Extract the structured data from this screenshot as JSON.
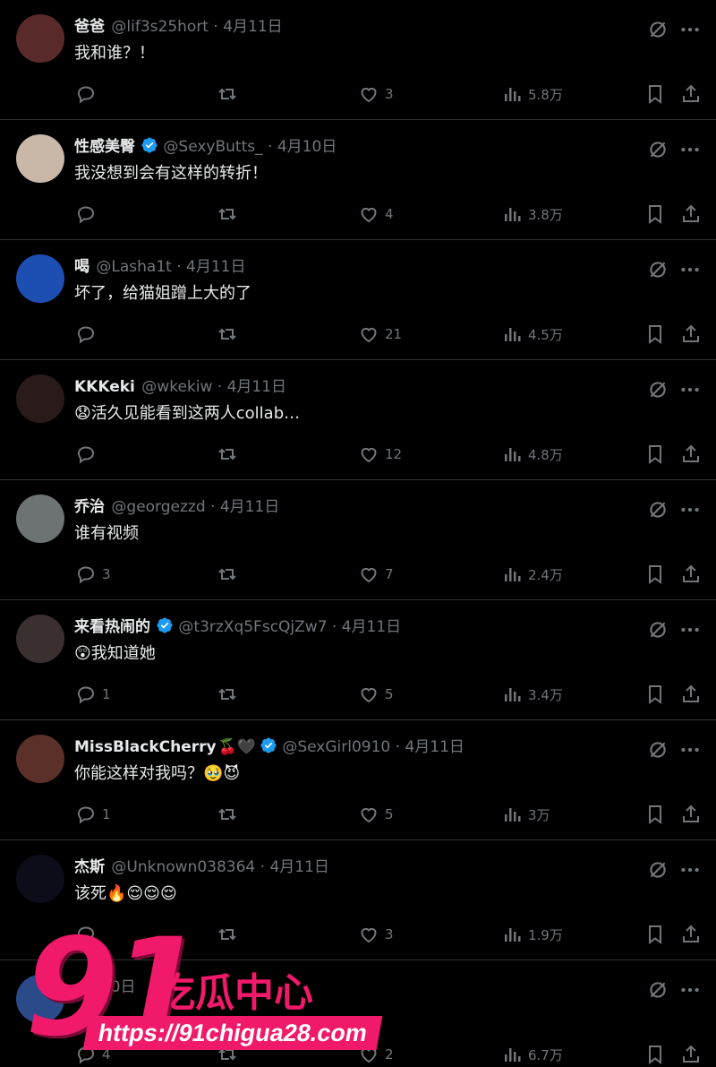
{
  "tweets": [
    {
      "name": "爸爸",
      "verified": false,
      "name_emojis": "",
      "handle": "@lif3s25hort",
      "date": "4月11日",
      "text": "我和谁？！",
      "replies": "",
      "retweets": "",
      "likes": "3",
      "views": "5.8万",
      "avatar_color": "#5a2a2a"
    },
    {
      "name": "性感美臀",
      "verified": true,
      "name_emojis": "",
      "handle": "@SexyButts_",
      "date": "4月10日",
      "text": "我没想到会有这样的转折！",
      "replies": "",
      "retweets": "",
      "likes": "4",
      "views": "3.8万",
      "avatar_color": "#c9b8a8"
    },
    {
      "name": "喝",
      "verified": false,
      "name_emojis": "",
      "handle": "@Lasha1t",
      "date": "4月11日",
      "text": "坏了，给猫姐蹭上大的了",
      "replies": "",
      "retweets": "",
      "likes": "21",
      "views": "4.5万",
      "avatar_color": "#1d4fb3"
    },
    {
      "name": "KKKeki",
      "verified": false,
      "name_emojis": "",
      "handle": "@wkekiw",
      "date": "4月11日",
      "text": "活久见能看到这两人collab…",
      "text_emoji": "😧",
      "replies": "",
      "retweets": "",
      "likes": "12",
      "views": "4.8万",
      "avatar_color": "#2a1a1a"
    },
    {
      "name": "乔治",
      "verified": false,
      "name_emojis": "",
      "handle": "@georgezzd",
      "date": "4月11日",
      "text": "谁有视频",
      "replies": "3",
      "retweets": "",
      "likes": "7",
      "views": "2.4万",
      "avatar_color": "#6d7373"
    },
    {
      "name": "来看热闹的",
      "verified": true,
      "name_emojis": "",
      "handle": "@t3rzXq5FscQjZw7",
      "date": "4月11日",
      "text": "我知道她",
      "text_emoji": "😲",
      "replies": "1",
      "retweets": "",
      "likes": "5",
      "views": "3.4万",
      "avatar_color": "#3a3030"
    },
    {
      "name": "MissBlackCherry",
      "verified": true,
      "name_emojis": "🍒🖤",
      "handle": "@SexGirl0910",
      "date": "4月11日",
      "text": "你能这样对我吗？🥹😈",
      "replies": "1",
      "retweets": "",
      "likes": "5",
      "views": "3万",
      "avatar_color": "#5a3028"
    },
    {
      "name": "杰斯",
      "verified": false,
      "name_emojis": "",
      "handle": "@Unknown038364",
      "date": "4月11日",
      "text": "该死🔥😌😌😌",
      "replies": "",
      "retweets": "",
      "likes": "3",
      "views": "1.9万",
      "avatar_color": "#0d0d1a"
    },
    {
      "name": "",
      "verified": false,
      "name_emojis": "",
      "handle": "",
      "date": "4月10日",
      "text": "",
      "replies": "4",
      "retweets": "",
      "likes": "2",
      "views": "6.7万",
      "avatar_color": "#2a4a8a"
    }
  ],
  "watermark": {
    "number": "91",
    "brand": "吃瓜中心",
    "url": "https://91chigua28.com"
  },
  "colors": {
    "background": "#000000",
    "text": "#e7e9ea",
    "muted": "#71767b",
    "verified": "#1d9bf0",
    "divider": "#2f3336",
    "watermark": "#f0196a"
  },
  "icons": [
    "reply-icon",
    "retweet-icon",
    "like-icon",
    "views-icon",
    "bookmark-icon",
    "share-icon",
    "grok-icon",
    "more-icon",
    "verified-icon"
  ]
}
